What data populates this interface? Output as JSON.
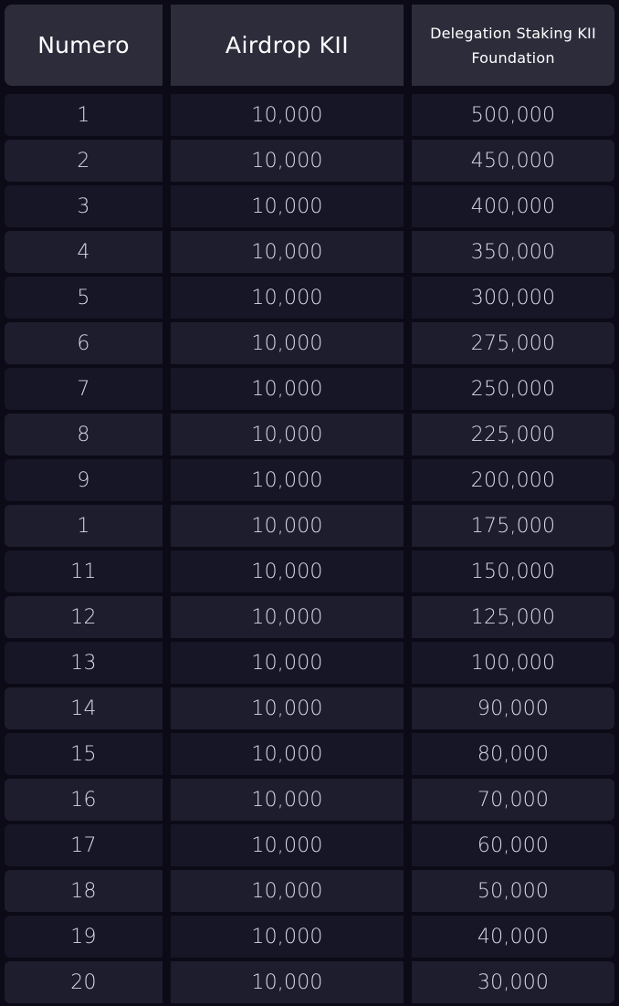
{
  "table": {
    "headers": [
      "Numero",
      "Airdrop KII",
      "Delegation Staking KII Foundation"
    ],
    "rows": [
      [
        "1",
        "10,000",
        "500,000"
      ],
      [
        "2",
        "10,000",
        "450,000"
      ],
      [
        "3",
        "10,000",
        "400,000"
      ],
      [
        "4",
        "10,000",
        "350,000"
      ],
      [
        "5",
        "10,000",
        "300,000"
      ],
      [
        "6",
        "10,000",
        "275,000"
      ],
      [
        "7",
        "10,000",
        "250,000"
      ],
      [
        "8",
        "10,000",
        "225,000"
      ],
      [
        "9",
        "10,000",
        "200,000"
      ],
      [
        "1",
        "10,000",
        "175,000"
      ],
      [
        "11",
        "10,000",
        "150,000"
      ],
      [
        "12",
        "10,000",
        "125,000"
      ],
      [
        "13",
        "10,000",
        "100,000"
      ],
      [
        "14",
        "10,000",
        "90,000"
      ],
      [
        "15",
        "10,000",
        "80,000"
      ],
      [
        "16",
        "10,000",
        "70,000"
      ],
      [
        "17",
        "10,000",
        "60,000"
      ],
      [
        "18",
        "10,000",
        "50,000"
      ],
      [
        "19",
        "10,000",
        "40,000"
      ],
      [
        "20",
        "10,000",
        "30,000"
      ]
    ]
  },
  "colors": {
    "background": "#0b0a16",
    "header_cell": "#2d2c3b",
    "row_cell_odd": "#171626",
    "row_cell_even": "#1e1d2e",
    "text": "#d9d8e6"
  }
}
